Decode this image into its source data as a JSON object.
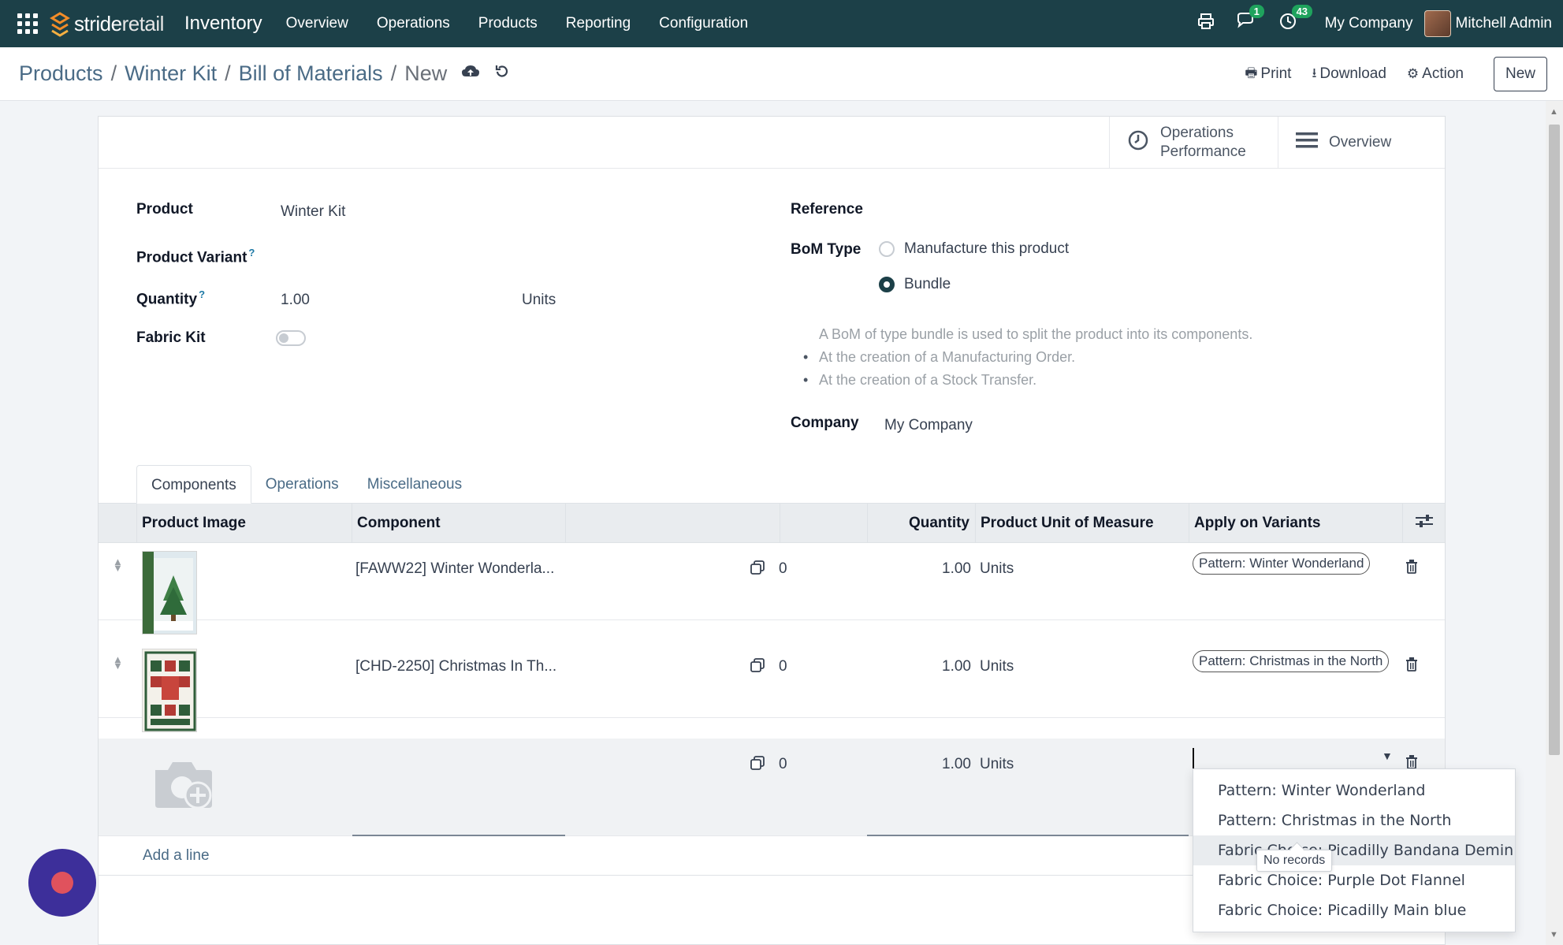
{
  "navbar": {
    "logo_part1": "stride",
    "logo_part2": "retail",
    "app_title": "Inventory",
    "menu": [
      "Overview",
      "Operations",
      "Products",
      "Reporting",
      "Configuration"
    ],
    "chat_badge": "1",
    "activity_badge": "43",
    "company": "My Company",
    "user": "Mitchell Admin",
    "accent_color": "#1c4048"
  },
  "breadcrumb": [
    "Products",
    "Winter Kit",
    "Bill of Materials",
    "New"
  ],
  "actions": {
    "print": "Print",
    "download": "Download",
    "action": "Action",
    "new": "New"
  },
  "stat_buttons": {
    "perf_line1": "Operations",
    "perf_line2": "Performance",
    "overview": "Overview"
  },
  "form": {
    "product_label": "Product",
    "product_value": "Winter Kit",
    "variant_label": "Product Variant",
    "quantity_label": "Quantity",
    "quantity_value": "1.00",
    "quantity_uom": "Units",
    "fabric_kit_label": "Fabric Kit",
    "fabric_kit_on": false,
    "reference_label": "Reference",
    "bom_type_label": "BoM Type",
    "bom_type_options": [
      "Manufacture this product",
      "Bundle"
    ],
    "bom_type_selected": "Bundle",
    "bom_help_intro": "A BoM of type bundle is used to split the product into its components.",
    "bom_help_items": [
      "At the creation of a Manufacturing Order.",
      "At the creation of a Stock Transfer."
    ],
    "company_label": "Company",
    "company_value": "My Company",
    "help_mark": "?"
  },
  "tabs": [
    "Components",
    "Operations",
    "Miscellaneous"
  ],
  "grid": {
    "headers": {
      "image": "Product Image",
      "component": "Component",
      "quantity": "Quantity",
      "uom": "Product Unit of Measure",
      "variants": "Apply on Variants"
    },
    "rows": [
      {
        "component": "[FAWW22] Winter Wonderla...",
        "count": "0",
        "quantity": "1.00",
        "uom": "Units",
        "variant_tag": "Pattern: Winter Wonderland"
      },
      {
        "component": "[CHD-2250] Christmas In Th...",
        "count": "0",
        "quantity": "1.00",
        "uom": "Units",
        "variant_tag": "Pattern: Christmas in the North"
      },
      {
        "component": "",
        "count": "0",
        "quantity": "1.00",
        "uom": "Units",
        "variant_tag": ""
      }
    ],
    "add_line": "Add a line"
  },
  "dropdown": {
    "options": [
      "Pattern: Winter Wonderland",
      "Pattern: Christmas in the North",
      "Fabric Choice: Picadilly Bandana Demin",
      "Fabric Choice: Purple Dot Flannel",
      "Fabric Choice: Picadilly Main blue"
    ],
    "highlighted_index": 2,
    "tooltip": "No records"
  }
}
